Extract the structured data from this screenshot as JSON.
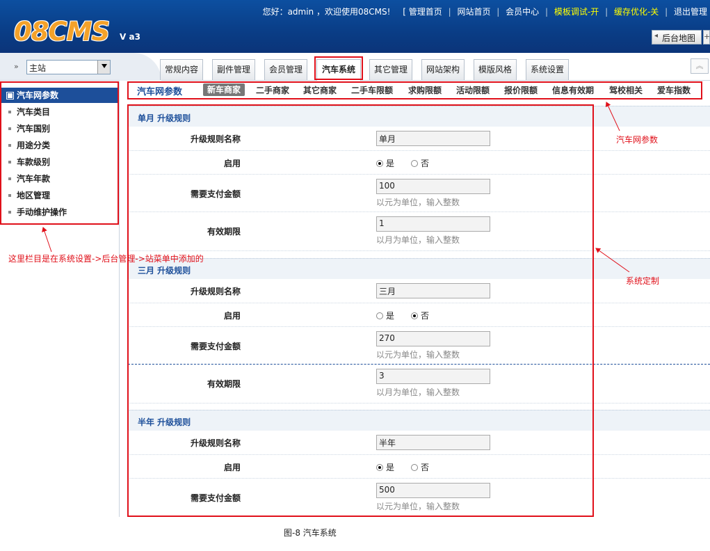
{
  "header": {
    "logo": "08CMS",
    "version": "V a3",
    "greeting": "您好：admin ，欢迎使用08CMS!",
    "links": [
      "[ 管理首页",
      "网站首页",
      "会员中心",
      "模板调试-开",
      "缓存优化-关",
      "退出管理"
    ],
    "sitemap_label": "后台地图",
    "plus_label": "+"
  },
  "site_bar": {
    "arrow": "»",
    "selected": "主站"
  },
  "tabs": [
    "常规内容",
    "副件管理",
    "会员管理",
    "汽车系统",
    "其它管理",
    "网站架构",
    "模版风格",
    "系统设置"
  ],
  "active_tab": "汽车系统",
  "scroll_icon": "︽",
  "sidebar": {
    "items": [
      "汽车网参数",
      "汽车类目",
      "汽车国别",
      "用途分类",
      "车款级别",
      "汽车年款",
      "地区管理",
      "手动维护操作"
    ]
  },
  "subnav": {
    "title": "汽车网参数",
    "items": [
      "新车商家",
      "二手商家",
      "其它商家",
      "二手车限额",
      "求购限额",
      "活动限额",
      "报价限额",
      "信息有效期",
      "驾校相关",
      "爱车指数"
    ]
  },
  "labels": {
    "rule_name": "升级规则名称",
    "enable": "启用",
    "amount": "需要支付金额",
    "period": "有效期限",
    "yes": "是",
    "no": "否",
    "amount_hint": "以元为单位，输入整数",
    "period_hint": "以月为单位，输入整数"
  },
  "sections": [
    {
      "title": "单月 升级规则",
      "name": "单月",
      "enabled": "是",
      "amount": "100",
      "period": "1"
    },
    {
      "title": "三月 升级规则",
      "name": "三月",
      "enabled": "否",
      "amount": "270",
      "period": "3"
    },
    {
      "title": "半年 升级规则",
      "name": "半年",
      "enabled": "是",
      "amount": "500"
    }
  ],
  "annotations": {
    "sidebar_note": "这里栏目是在系统设置->后台管理->站菜单中添加的",
    "subnav_note": "汽车网参数",
    "main_note": "系统定制"
  },
  "caption": "图-8 汽车系统"
}
